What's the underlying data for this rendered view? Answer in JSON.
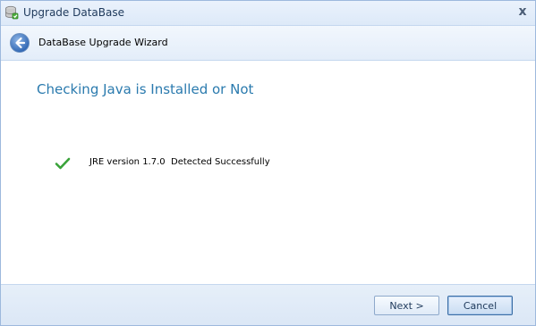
{
  "window": {
    "title": "Upgrade DataBase",
    "close_glyph": "x",
    "icon": "database-icon"
  },
  "wizard": {
    "header_title": "DataBase Upgrade Wizard",
    "back_icon": "back-arrow-icon"
  },
  "content": {
    "heading": "Checking Java is Installed or Not",
    "status_icon": "check-icon",
    "status_text": "JRE version 1.7.0  Detected Successfully"
  },
  "footer": {
    "next_label": "Next >",
    "cancel_label": "Cancel"
  },
  "colors": {
    "heading": "#2a7aae",
    "check": "#3aa33a",
    "title_text": "#1e395b"
  }
}
